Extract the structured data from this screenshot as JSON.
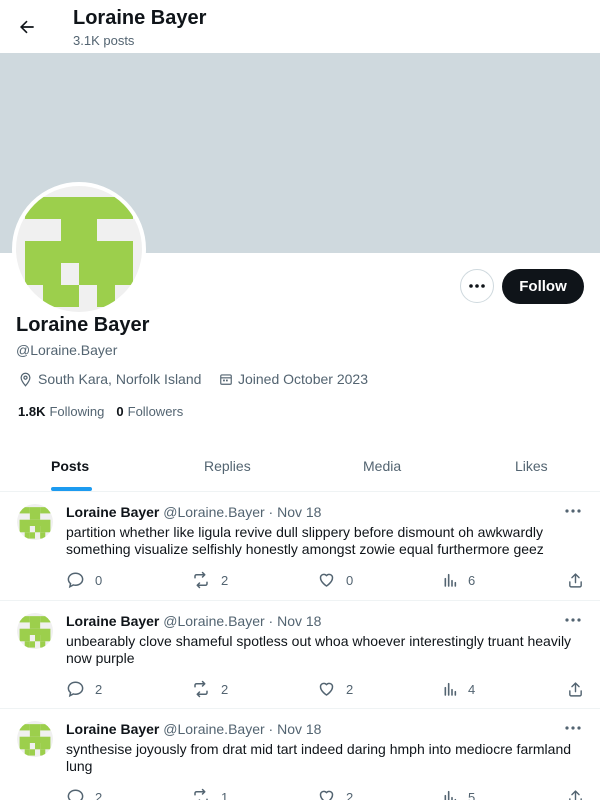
{
  "header": {
    "title": "Loraine Bayer",
    "post_count": "3.1K posts"
  },
  "profile": {
    "name": "Loraine Bayer",
    "handle": "@Loraine.Bayer",
    "location": "South Kara, Norfolk Island",
    "joined": "Joined October 2023",
    "following_count": "1.8K",
    "following_label": "Following",
    "followers_count": "0",
    "followers_label": "Followers",
    "follow_label": "Follow"
  },
  "tabs": [
    {
      "label": "Posts"
    },
    {
      "label": "Replies"
    },
    {
      "label": "Media"
    },
    {
      "label": "Likes"
    }
  ],
  "posts": [
    {
      "name": "Loraine Bayer",
      "handle": "@Loraine.Bayer",
      "sep": "·",
      "date": "Nov 18",
      "text": "partition whether like ligula revive dull slippery before dismount oh awkwardly something visualize selfishly honestly amongst zowie equal furthermore geez",
      "replies": "0",
      "reposts": "2",
      "likes": "0",
      "views": "6"
    },
    {
      "name": "Loraine Bayer",
      "handle": "@Loraine.Bayer",
      "sep": "·",
      "date": "Nov 18",
      "text": "unbearably clove shameful spotless out whoa whoever interestingly truant heavily now purple",
      "replies": "2",
      "reposts": "2",
      "likes": "2",
      "views": "4"
    },
    {
      "name": "Loraine Bayer",
      "handle": "@Loraine.Bayer",
      "sep": "·",
      "date": "Nov 18",
      "text": "synthesise joyously from drat mid tart indeed daring hmph into mediocre farmland lung",
      "replies": "2",
      "reposts": "1",
      "likes": "2",
      "views": "5"
    }
  ],
  "colors": {
    "accent": "#1d9bf0",
    "avatar_green": "#9ccf4c",
    "banner": "#cfd9de"
  }
}
